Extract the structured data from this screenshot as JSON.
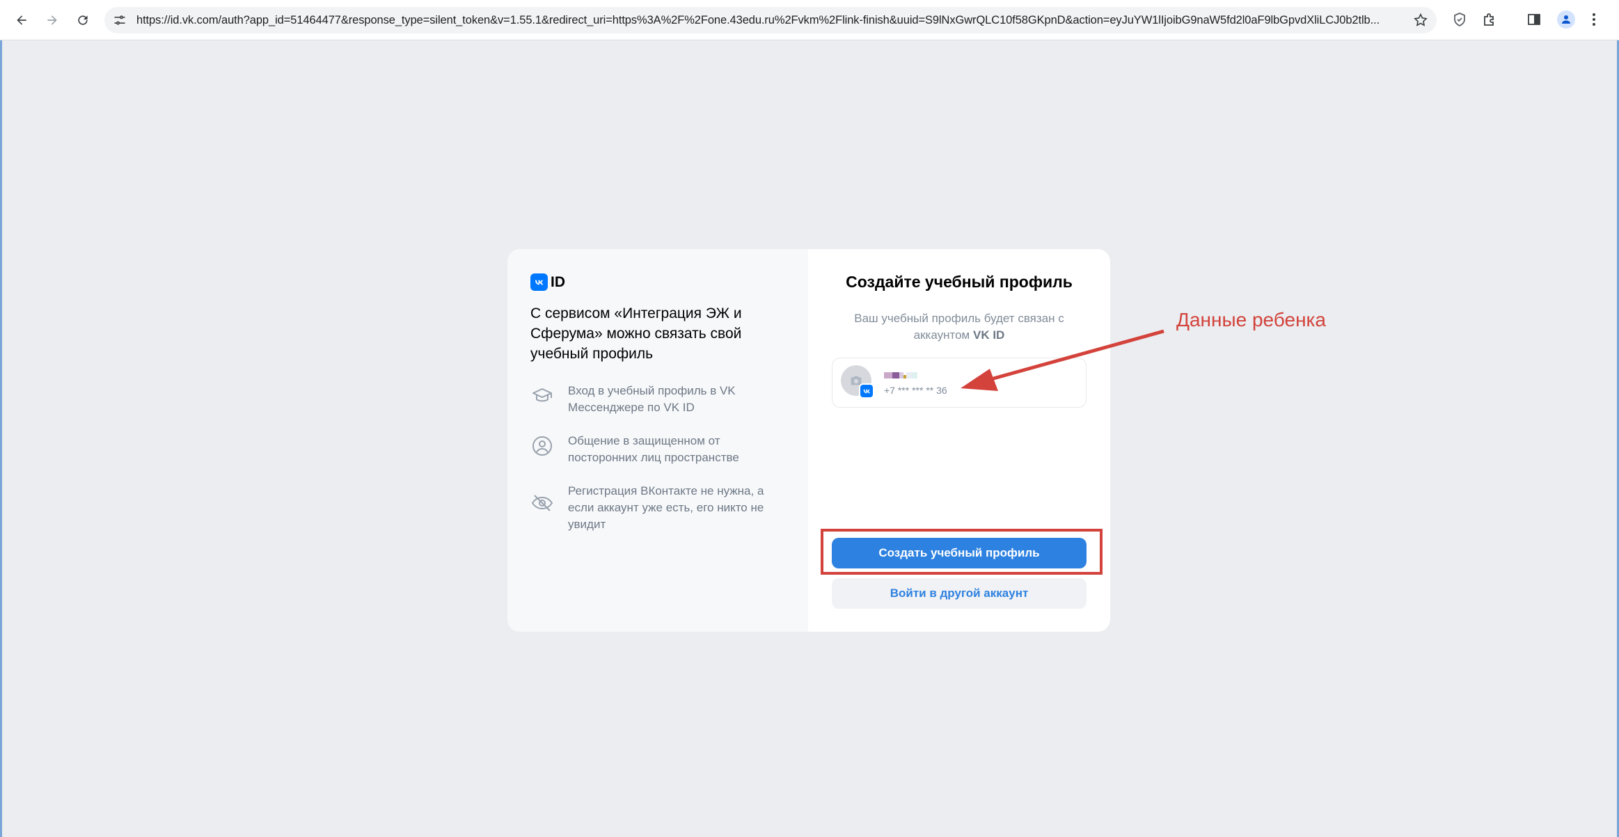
{
  "browser": {
    "url": "https://id.vk.com/auth?app_id=51464477&response_type=silent_token&v=1.55.1&redirect_uri=https%3A%2F%2Fone.43edu.ru%2Fvkm%2Flink-finish&uuid=S9lNxGwrQLC10f58GKpnD&action=eyJuYW1lIjoibG9naW5fd2l0aF9lbGpvdXliLCJ0b2tlb..."
  },
  "card": {
    "logo_text": "ID",
    "left_heading": "С сервисом «Интеграция ЭЖ и Сферума» можно связать свой учебный профиль",
    "features": [
      {
        "icon": "graduation-cap-icon",
        "text": "Вход в учебный профиль в VK Мессенджере по VK ID"
      },
      {
        "icon": "user-circle-icon",
        "text": "Общение в защищенном от посторонних лиц пространстве"
      },
      {
        "icon": "eye-off-icon",
        "text": "Регистрация ВКонтакте не нужна, а если аккаунт уже есть, его никто не увидит"
      }
    ],
    "right_title": "Создайте учебный профиль",
    "right_sub_prefix": "Ваш учебный профиль будет связан с аккаунтом",
    "right_sub_bold": "VK ID",
    "account": {
      "phone": "+7 *** *** ** 36"
    },
    "primary_button": "Создать учебный профиль",
    "secondary_button": "Войти в другой аккаунт"
  },
  "annotation": {
    "label": "Данные ребенка",
    "color": "#d3423b"
  },
  "colors": {
    "accent": "#2d81e0",
    "vk_blue": "#0077ff",
    "background": "#ebedf0"
  }
}
